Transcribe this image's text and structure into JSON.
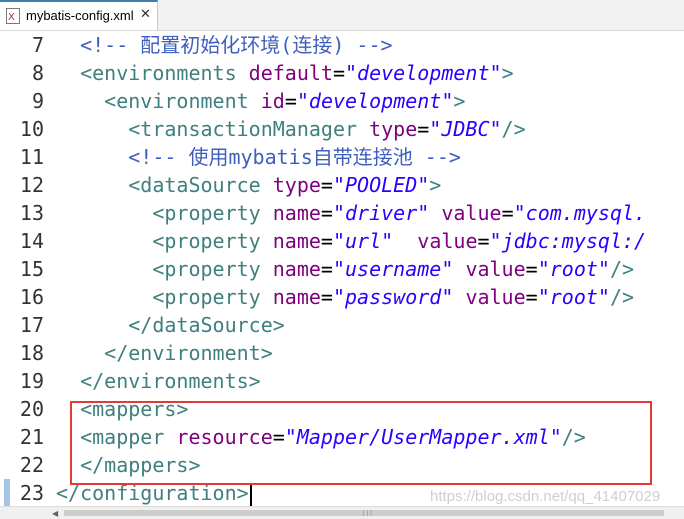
{
  "tab": {
    "title": "mybatis-config.xml",
    "close_glyph": "✕",
    "icon": "xml-file-icon"
  },
  "lines": [
    {
      "num": "7",
      "segs": [
        {
          "t": "  "
        },
        {
          "c": "cmt",
          "t": "<!-- 配置初始化环境(连接) -->"
        }
      ]
    },
    {
      "num": "8",
      "segs": [
        {
          "t": "  "
        },
        {
          "c": "tag",
          "t": "<environments "
        },
        {
          "c": "attr",
          "t": "default"
        },
        {
          "c": "eq",
          "t": "="
        },
        {
          "c": "val",
          "t": "\"development\""
        },
        {
          "c": "tag",
          "t": ">"
        }
      ]
    },
    {
      "num": "9",
      "segs": [
        {
          "t": "    "
        },
        {
          "c": "tag",
          "t": "<environment "
        },
        {
          "c": "attr",
          "t": "id"
        },
        {
          "c": "eq",
          "t": "="
        },
        {
          "c": "val",
          "t": "\"development\""
        },
        {
          "c": "tag",
          "t": ">"
        }
      ]
    },
    {
      "num": "10",
      "segs": [
        {
          "t": "      "
        },
        {
          "c": "tag",
          "t": "<transactionManager "
        },
        {
          "c": "attr",
          "t": "type"
        },
        {
          "c": "eq",
          "t": "="
        },
        {
          "c": "val",
          "t": "\"JDBC\""
        },
        {
          "c": "tag",
          "t": "/>"
        }
      ]
    },
    {
      "num": "11",
      "segs": [
        {
          "t": "      "
        },
        {
          "c": "cmt",
          "t": "<!-- 使用mybatis自带连接池 -->"
        }
      ]
    },
    {
      "num": "12",
      "segs": [
        {
          "t": "      "
        },
        {
          "c": "tag",
          "t": "<dataSource "
        },
        {
          "c": "attr",
          "t": "type"
        },
        {
          "c": "eq",
          "t": "="
        },
        {
          "c": "val",
          "t": "\"POOLED\""
        },
        {
          "c": "tag",
          "t": ">"
        }
      ]
    },
    {
      "num": "13",
      "segs": [
        {
          "t": "        "
        },
        {
          "c": "tag",
          "t": "<property "
        },
        {
          "c": "attr",
          "t": "name"
        },
        {
          "c": "eq",
          "t": "="
        },
        {
          "c": "val",
          "t": "\"driver\""
        },
        {
          "t": " "
        },
        {
          "c": "attr",
          "t": "value"
        },
        {
          "c": "eq",
          "t": "="
        },
        {
          "c": "val",
          "t": "\"com.mysql."
        }
      ]
    },
    {
      "num": "14",
      "segs": [
        {
          "t": "        "
        },
        {
          "c": "tag",
          "t": "<property "
        },
        {
          "c": "attr",
          "t": "name"
        },
        {
          "c": "eq",
          "t": "="
        },
        {
          "c": "val",
          "t": "\"url\""
        },
        {
          "t": "  "
        },
        {
          "c": "attr",
          "t": "value"
        },
        {
          "c": "eq",
          "t": "="
        },
        {
          "c": "val",
          "t": "\"jdbc:mysql:/"
        }
      ]
    },
    {
      "num": "15",
      "segs": [
        {
          "t": "        "
        },
        {
          "c": "tag",
          "t": "<property "
        },
        {
          "c": "attr",
          "t": "name"
        },
        {
          "c": "eq",
          "t": "="
        },
        {
          "c": "val",
          "t": "\"username\""
        },
        {
          "t": " "
        },
        {
          "c": "attr",
          "t": "value"
        },
        {
          "c": "eq",
          "t": "="
        },
        {
          "c": "val",
          "t": "\"root\""
        },
        {
          "c": "tag",
          "t": "/>"
        }
      ]
    },
    {
      "num": "16",
      "segs": [
        {
          "t": "        "
        },
        {
          "c": "tag",
          "t": "<property "
        },
        {
          "c": "attr",
          "t": "name"
        },
        {
          "c": "eq",
          "t": "="
        },
        {
          "c": "val",
          "t": "\"password\""
        },
        {
          "t": " "
        },
        {
          "c": "attr",
          "t": "value"
        },
        {
          "c": "eq",
          "t": "="
        },
        {
          "c": "val",
          "t": "\"root\""
        },
        {
          "c": "tag",
          "t": "/>"
        }
      ]
    },
    {
      "num": "17",
      "segs": [
        {
          "t": "      "
        },
        {
          "c": "tag",
          "t": "</dataSource>"
        }
      ]
    },
    {
      "num": "18",
      "segs": [
        {
          "t": "    "
        },
        {
          "c": "tag",
          "t": "</environment>"
        }
      ]
    },
    {
      "num": "19",
      "segs": [
        {
          "t": "  "
        },
        {
          "c": "tag",
          "t": "</environments>"
        }
      ]
    },
    {
      "num": "20",
      "segs": [
        {
          "t": "  "
        },
        {
          "c": "tag",
          "t": "<mappers>"
        }
      ]
    },
    {
      "num": "21",
      "segs": [
        {
          "t": "  "
        },
        {
          "c": "tag",
          "t": "<mapper "
        },
        {
          "c": "attr",
          "t": "resource"
        },
        {
          "c": "eq",
          "t": "="
        },
        {
          "c": "val",
          "t": "\"Mapper/UserMapper.xml\""
        },
        {
          "c": "tag",
          "t": "/>"
        }
      ]
    },
    {
      "num": "22",
      "segs": [
        {
          "t": "  "
        },
        {
          "c": "tag",
          "t": "</mappers>"
        }
      ]
    },
    {
      "num": "23",
      "segs": [
        {
          "c": "tag",
          "t": "</configuration>"
        }
      ],
      "current": true
    }
  ],
  "scrollbar": {
    "left_arrow": "◀",
    "grip": "|||"
  },
  "watermark": "https://blog.csdn.net/qq_41407029",
  "colors": {
    "tag": "#3f7f7f",
    "attribute": "#7f007f",
    "value": "#2a00ff",
    "comment": "#3f5fbf",
    "highlight_box": "#e53935"
  }
}
